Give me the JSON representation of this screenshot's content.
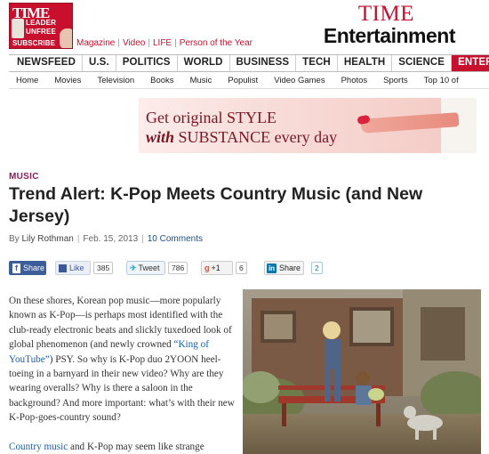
{
  "masthead": {
    "cover": {
      "masthead_text": "TIME",
      "line1": "LEADER",
      "line2": "UNFREE",
      "subscribe": "SUBSCRIBE"
    },
    "top_links": [
      "Magazine",
      "Video",
      "LIFE",
      "Person of the Year"
    ],
    "brand_time": "TIME",
    "brand_section": "Entertainment"
  },
  "primary_nav": [
    "NEWSFEED",
    "U.S.",
    "POLITICS",
    "WORLD",
    "BUSINESS",
    "TECH",
    "HEALTH",
    "SCIENCE",
    "ENTERTA"
  ],
  "primary_nav_active_index": 8,
  "secondary_nav": [
    "Home",
    "Movies",
    "Television",
    "Books",
    "Music",
    "Populist",
    "Video Games",
    "Photos",
    "Sports",
    "Top 10 of"
  ],
  "ad": {
    "line1": "Get original STYLE",
    "line2_italic": "with",
    "line2_rest": "SUBSTANCE every day"
  },
  "article": {
    "section": "MUSIC",
    "headline": "Trend Alert: K-Pop Meets Country Music (and New Jersey)",
    "byline_prefix": "By",
    "author": "Lily Rothman",
    "date": "Feb. 15, 2013",
    "comments": "10 Comments"
  },
  "share": {
    "share_label": "Share",
    "like_label": "Like",
    "like_count": "385",
    "tweet_label": "Tweet",
    "tweet_count": "786",
    "gplus_label": "+1",
    "gplus_count": "6",
    "in_label": "Share",
    "in_count": "2"
  },
  "body": {
    "p1_a": "On these shores, Korean pop music—more popularly known as K-Pop—is perhaps most identified with the club-ready electronic beats and slickly tuxedoed look of global phenomenon (and newly crowned ",
    "p1_link": "“King of YouTube”",
    "p1_b": ") PSY. So why is K-Pop duo 2YOON heel-toeing in a barnyard in their new video? Why are they wearing overalls? Why is there a saloon in the background? And more important: what’s with their new K-Pop-goes-country sound?",
    "p2_link": "Country music",
    "p2_rest": " and K-Pop may seem like strange"
  },
  "colors": {
    "time_red": "#c8102e",
    "section_purple": "#8a1d5a",
    "link_blue": "#1c5fa8",
    "facebook_blue": "#3b5e99"
  }
}
